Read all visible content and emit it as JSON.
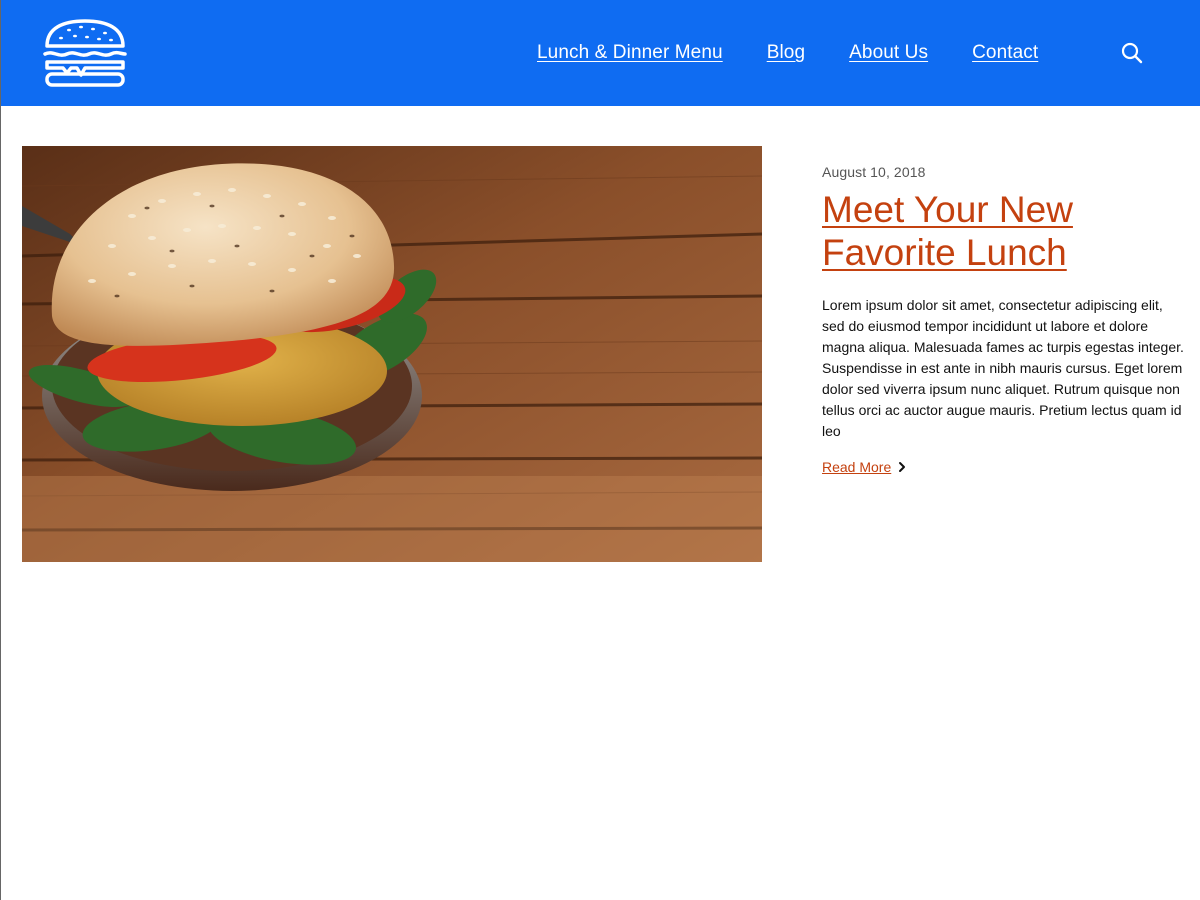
{
  "colors": {
    "header_bg": "#0f6cf2",
    "accent": "#c4410f",
    "text": "#111111",
    "muted": "#555555"
  },
  "header": {
    "logo_icon": "burger-logo-icon",
    "nav": [
      {
        "label": "Lunch & Dinner Menu"
      },
      {
        "label": "Blog"
      },
      {
        "label": "About Us"
      },
      {
        "label": "Contact"
      }
    ],
    "search_icon": "search-icon"
  },
  "post": {
    "image_subject": "burger on wooden table",
    "date": "August 10, 2018",
    "title": "Meet Your New Favorite Lunch",
    "excerpt": "Lorem ipsum dolor sit amet, consectetur adipiscing elit, sed do eiusmod tempor incididunt ut labore et dolore magna aliqua. Malesuada fames ac turpis egestas integer. Suspendisse in est ante in nibh mauris cursus. Eget lorem dolor sed viverra ipsum nunc aliquet. Rutrum quisque non tellus orci ac auctor augue mauris. Pretium lectus quam id leo",
    "read_more": "Read More"
  }
}
